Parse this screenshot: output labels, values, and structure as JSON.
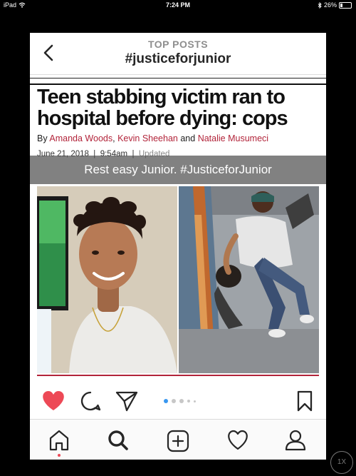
{
  "status_bar": {
    "device": "iPad",
    "time": "7:24 PM",
    "battery": "26%",
    "battery_level": 0.26
  },
  "header": {
    "subtitle": "TOP POSTS",
    "title": "#justiceforjunior"
  },
  "post": {
    "headline": "Teen stabbing victim ran to hospital before dying: cops",
    "byline_prefix": "By",
    "author1": "Amanda Woods",
    "sep1": ",",
    "author2": "Kevin Sheehan",
    "sep2": "and",
    "author3": "Natalie Musumeci",
    "date": "June 21, 2018",
    "time": "9:54am",
    "updated": "Updated",
    "caption": "Rest easy Junior. #JusticeforJunior"
  },
  "carousel": {
    "count": 5,
    "active_index": 0
  },
  "colors": {
    "like": "#ed4956",
    "accent": "#3897f0",
    "byline_link": "#b2243a"
  },
  "icons": {
    "back": "chevron-left-icon",
    "like": "heart-filled-icon",
    "comment": "comment-icon",
    "share": "paper-plane-icon",
    "save": "bookmark-icon",
    "tabs": [
      "home-icon",
      "search-icon",
      "add-post-icon",
      "activity-heart-icon",
      "profile-icon"
    ]
  },
  "zoom_label": "1X"
}
